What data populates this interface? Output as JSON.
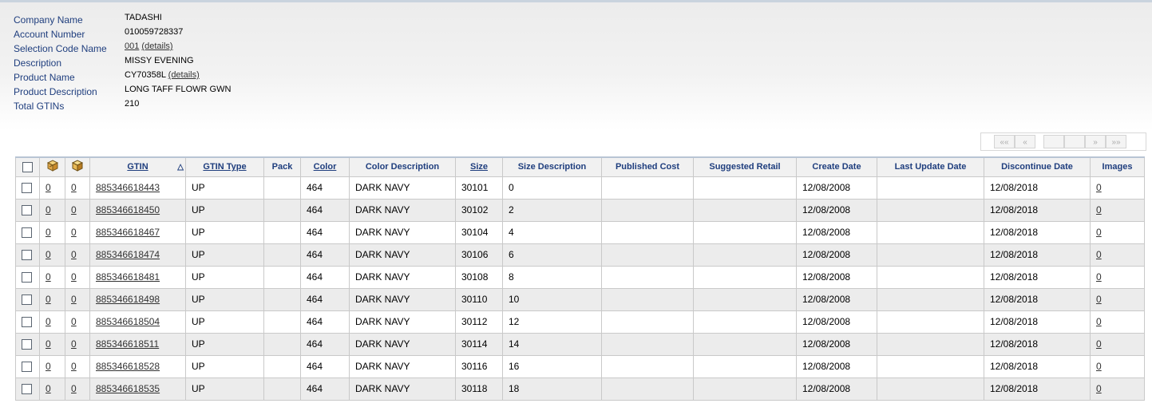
{
  "info": {
    "company_name": {
      "label": "Company Name",
      "value": "TADASHI"
    },
    "account_number": {
      "label": "Account Number",
      "value": "010059728337"
    },
    "selection_code_name": {
      "label": "Selection Code Name",
      "value": "001",
      "details": "(details)"
    },
    "description": {
      "label": "Description",
      "value": "MISSY EVENING"
    },
    "product_name": {
      "label": "Product Name",
      "value": "CY70358L",
      "details": "(details)"
    },
    "product_description": {
      "label": "Product Description",
      "value": "LONG TAFF FLOWR GWN"
    },
    "total_gtins": {
      "label": "Total GTINs",
      "value": "210"
    }
  },
  "pager": {
    "first": "««",
    "prev": "«",
    "page": "",
    "next": "»",
    "last": "»»"
  },
  "table": {
    "headers": {
      "gtin": "GTIN",
      "gtin_type": "GTIN Type",
      "pack": "Pack",
      "color": "Color",
      "color_description": "Color Description",
      "size": "Size",
      "size_description": "Size Description",
      "published_cost": "Published Cost",
      "suggested_retail": "Suggested Retail",
      "create_date": "Create Date",
      "last_update_date": "Last Update Date",
      "discontinue_date": "Discontinue Date",
      "images": "Images"
    },
    "header_icons": [
      "case-box-icon",
      "package-box-icon"
    ],
    "sort_icon": "sort-up-triangle-icon",
    "rows": [
      {
        "c1": "0",
        "c2": "0",
        "gtin": "885346618443",
        "type": "UP",
        "pack": "",
        "color": "464",
        "color_desc": "DARK NAVY",
        "size": "30101",
        "size_desc": "0",
        "cost": "",
        "retail": "",
        "create": "12/08/2008",
        "update": "",
        "discontinue": "12/08/2018",
        "images": "0"
      },
      {
        "c1": "0",
        "c2": "0",
        "gtin": "885346618450",
        "type": "UP",
        "pack": "",
        "color": "464",
        "color_desc": "DARK NAVY",
        "size": "30102",
        "size_desc": "2",
        "cost": "",
        "retail": "",
        "create": "12/08/2008",
        "update": "",
        "discontinue": "12/08/2018",
        "images": "0"
      },
      {
        "c1": "0",
        "c2": "0",
        "gtin": "885346618467",
        "type": "UP",
        "pack": "",
        "color": "464",
        "color_desc": "DARK NAVY",
        "size": "30104",
        "size_desc": "4",
        "cost": "",
        "retail": "",
        "create": "12/08/2008",
        "update": "",
        "discontinue": "12/08/2018",
        "images": "0"
      },
      {
        "c1": "0",
        "c2": "0",
        "gtin": "885346618474",
        "type": "UP",
        "pack": "",
        "color": "464",
        "color_desc": "DARK NAVY",
        "size": "30106",
        "size_desc": "6",
        "cost": "",
        "retail": "",
        "create": "12/08/2008",
        "update": "",
        "discontinue": "12/08/2018",
        "images": "0"
      },
      {
        "c1": "0",
        "c2": "0",
        "gtin": "885346618481",
        "type": "UP",
        "pack": "",
        "color": "464",
        "color_desc": "DARK NAVY",
        "size": "30108",
        "size_desc": "8",
        "cost": "",
        "retail": "",
        "create": "12/08/2008",
        "update": "",
        "discontinue": "12/08/2018",
        "images": "0"
      },
      {
        "c1": "0",
        "c2": "0",
        "gtin": "885346618498",
        "type": "UP",
        "pack": "",
        "color": "464",
        "color_desc": "DARK NAVY",
        "size": "30110",
        "size_desc": "10",
        "cost": "",
        "retail": "",
        "create": "12/08/2008",
        "update": "",
        "discontinue": "12/08/2018",
        "images": "0"
      },
      {
        "c1": "0",
        "c2": "0",
        "gtin": "885346618504",
        "type": "UP",
        "pack": "",
        "color": "464",
        "color_desc": "DARK NAVY",
        "size": "30112",
        "size_desc": "12",
        "cost": "",
        "retail": "",
        "create": "12/08/2008",
        "update": "",
        "discontinue": "12/08/2018",
        "images": "0"
      },
      {
        "c1": "0",
        "c2": "0",
        "gtin": "885346618511",
        "type": "UP",
        "pack": "",
        "color": "464",
        "color_desc": "DARK NAVY",
        "size": "30114",
        "size_desc": "14",
        "cost": "",
        "retail": "",
        "create": "12/08/2008",
        "update": "",
        "discontinue": "12/08/2018",
        "images": "0"
      },
      {
        "c1": "0",
        "c2": "0",
        "gtin": "885346618528",
        "type": "UP",
        "pack": "",
        "color": "464",
        "color_desc": "DARK NAVY",
        "size": "30116",
        "size_desc": "16",
        "cost": "",
        "retail": "",
        "create": "12/08/2008",
        "update": "",
        "discontinue": "12/08/2018",
        "images": "0"
      },
      {
        "c1": "0",
        "c2": "0",
        "gtin": "885346618535",
        "type": "UP",
        "pack": "",
        "color": "464",
        "color_desc": "DARK NAVY",
        "size": "30118",
        "size_desc": "18",
        "cost": "",
        "retail": "",
        "create": "12/08/2008",
        "update": "",
        "discontinue": "12/08/2018",
        "images": "0"
      }
    ]
  },
  "colors": {
    "label_blue": "#1f3e7e",
    "row_alt": "#ececec",
    "border": "#c9c9c9"
  }
}
